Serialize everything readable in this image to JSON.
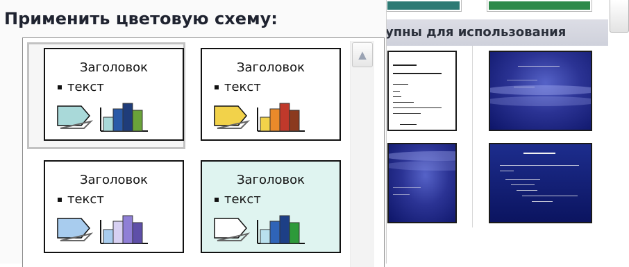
{
  "dialog": {
    "title": "Применить цветовую схему:"
  },
  "background_pane": {
    "caption": "упны для использования",
    "top_thumb_colors": [
      "#2d7a74",
      "#2e8a4a"
    ]
  },
  "schemes": [
    {
      "heading": "Заголовок",
      "bullet": "текст",
      "selected": true,
      "background": "#ffffff",
      "arrow_color": "#a9d9d9",
      "bar_colors": [
        "#a9d9d9",
        "#2a5aa8",
        "#1f3c7a",
        "#6aa33a"
      ]
    },
    {
      "heading": "Заголовок",
      "bullet": "текст",
      "selected": false,
      "background": "#ffffff",
      "arrow_color": "#f2d24a",
      "bar_colors": [
        "#f2d24a",
        "#e98a2a",
        "#c0392b",
        "#8b3a1e"
      ]
    },
    {
      "heading": "Заголовок",
      "bullet": "текст",
      "selected": false,
      "background": "#ffffff",
      "arrow_color": "#a8ccee",
      "bar_colors": [
        "#a8ccee",
        "#d7d0f2",
        "#8f7fd6",
        "#5e4fa8"
      ]
    },
    {
      "heading": "Заголовок",
      "bullet": "текст",
      "selected": false,
      "background": "#dff4f0",
      "arrow_color": "#ffffff",
      "bar_colors": [
        "#b9e0ee",
        "#2f64b8",
        "#1d3f86",
        "#2d9a3a"
      ]
    }
  ],
  "icons": {
    "scroll_up": "chevron-up-icon",
    "arrow": "arrow-shape-icon",
    "chart": "bar-chart-icon"
  }
}
